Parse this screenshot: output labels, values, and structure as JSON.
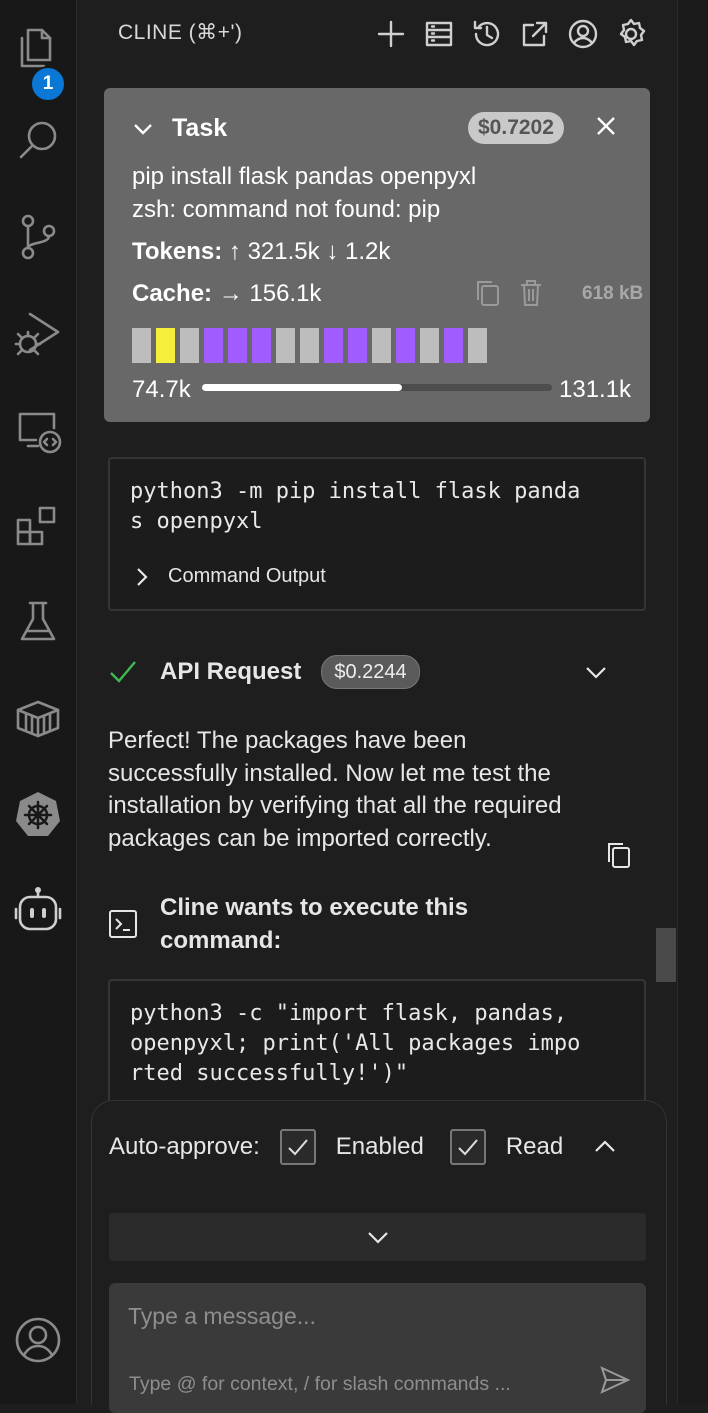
{
  "activity_bar": {
    "explorer_badge": "1",
    "icons": [
      "files-icon",
      "search-icon",
      "source-control-icon",
      "run-debug-icon",
      "remote-explorer-icon",
      "extensions-icon",
      "testing-icon",
      "containers-icon",
      "kubernetes-icon",
      "cline-icon",
      "account-icon"
    ]
  },
  "header": {
    "title": "CLINE (⌘+')",
    "buttons": [
      "new-task-icon",
      "mcp-servers-icon",
      "history-icon",
      "popout-icon",
      "account-icon",
      "settings-icon"
    ]
  },
  "task": {
    "title": "Task",
    "cost": "$0.7202",
    "text": "pip install flask pandas openpyxl\nzsh: command not found: pip",
    "tokens_label": "Tokens:",
    "tokens_up": "↑ 321.5k",
    "tokens_down": "↓ 1.2k",
    "cache_label": "Cache:",
    "cache_value": "→ 156.1k",
    "size": "618 kB",
    "context_blocks": [
      "gray",
      "yellow",
      "gray",
      "purple",
      "purple",
      "purple",
      "gray",
      "gray",
      "purple",
      "purple",
      "gray",
      "purple",
      "gray",
      "purple",
      "gray"
    ],
    "progress_left": "74.7k",
    "progress_right": "131.1k",
    "progress_fraction": 0.57
  },
  "command1": {
    "text": "python3 -m pip install flask panda\ns openpyxl",
    "output_label": "Command Output"
  },
  "api_request": {
    "title": "API Request",
    "cost": "$0.2244"
  },
  "message": "Perfect! The packages have been\nsuccessfully installed. Now let me test the\ninstallation by verifying that all the required\npackages can be imported correctly.",
  "exec": {
    "title": "Cline wants to execute this\ncommand:"
  },
  "command2": {
    "text": "python3 -c \"import flask, pandas,\nopenpyxl; print('All packages impo\nrted successfully!')\""
  },
  "auto_approve": {
    "label": "Auto-approve:",
    "options": [
      "Enabled",
      "Read"
    ]
  },
  "input": {
    "placeholder": "Type a message...",
    "hint": "Type @ for context, / for slash commands ..."
  },
  "colors": {
    "accent_purple": "#a05cff",
    "accent_yellow": "#f5ee3a",
    "badge_blue": "#0a78d4",
    "check_green": "#3fb950"
  }
}
